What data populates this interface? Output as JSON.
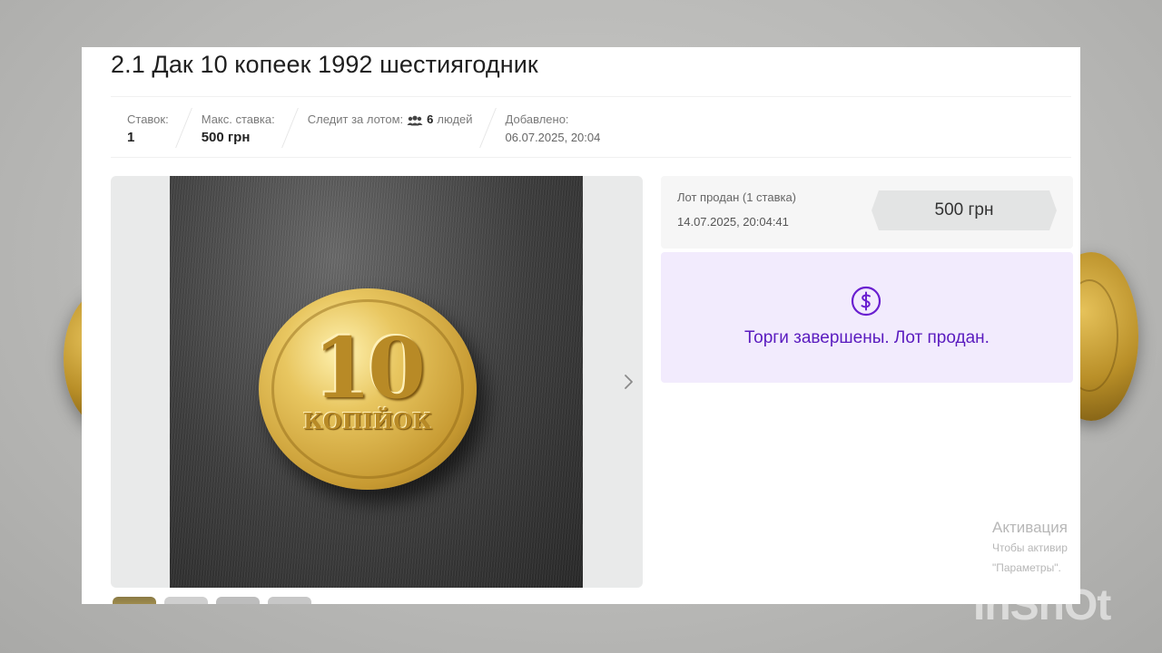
{
  "lot": {
    "title": "2.1 Дак 10 копеек 1992 шестиягодник"
  },
  "stats": {
    "bids_label": "Ставок:",
    "bids_value": "1",
    "max_bid_label": "Макс. ставка:",
    "max_bid_value": "500 грн",
    "watchers_label": "Следит за лотом:",
    "watchers_count": "6",
    "watchers_unit": "людей",
    "added_label": "Добавлено:",
    "added_value": "06.07.2025, 20:04"
  },
  "gallery": {
    "coin_denomination": "10",
    "coin_word": "КОПІЙОК",
    "thumbnail_count": 4
  },
  "sale": {
    "status": "Лот продан (1 ставка)",
    "datetime": "14.07.2025, 20:04:41",
    "price": "500 грн"
  },
  "result": {
    "message": "Торги завершены. Лот продан.",
    "icon": "dollar-coin-icon",
    "accent_color": "#5a1bbf",
    "background_color": "#f2ebfd"
  },
  "overlay": {
    "activation_title": "Активация",
    "activation_line1": "Чтобы активир",
    "activation_line2": "\"Параметры\".",
    "watermark": "InShOt"
  }
}
